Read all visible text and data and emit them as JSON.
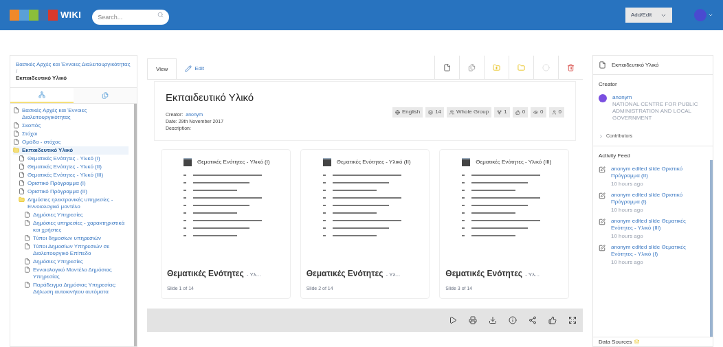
{
  "header": {
    "logo": "WIKI",
    "search": {
      "placeholder": "Search..."
    },
    "add_button": "Add/Edit"
  },
  "breadcrumb": {
    "parent": "Βασικές Αρχές και Έννοιες Διαλειτουργικότητας",
    "separator": "/",
    "current": "Εκπαιδευτικό Υλικό"
  },
  "sidebar_tabs": [
    {
      "kind": "tree",
      "selected": true
    },
    {
      "kind": "pages",
      "selected": false
    }
  ],
  "tree": [
    {
      "label": "Βασικές Αρχές και Έννοιες Διαλειτουργικότητας",
      "kind": "page",
      "selected": false
    },
    {
      "label": "Σκοπός",
      "kind": "page",
      "selected": false
    },
    {
      "label": "Στόχοι",
      "kind": "page",
      "selected": false
    },
    {
      "label": "Ομάδα - στόχος",
      "kind": "page",
      "selected": false
    },
    {
      "label": "Εκπαιδευτικό Υλικό",
      "kind": "folder",
      "selected": true,
      "children": [
        {
          "label": "Θεματικές Ενότητες - Υλικό (I)",
          "kind": "page",
          "selected": false
        },
        {
          "label": "Θεματικές Ενότητες - Υλικό (II)",
          "kind": "page",
          "selected": false
        },
        {
          "label": "Θεματικές Ενότητες - Υλικό (III)",
          "kind": "page",
          "selected": false
        },
        {
          "label": "Οριστικό Πρόγραμμα (I)",
          "kind": "page",
          "selected": false
        },
        {
          "label": "Οριστικό Πρόγραμμα (II)",
          "kind": "page",
          "selected": false
        },
        {
          "label": "Δημόσιες ηλεκτρονικές υπηρεσίες - Εννοιολογικό μοντέλο",
          "kind": "folder",
          "selected": false,
          "children": [
            {
              "label": "Δημόσιες Υπηρεσίες",
              "kind": "page",
              "selected": false
            },
            {
              "label": "Δημόσιες υπηρεσίες - χαρακτηριστικά και χρήστες",
              "kind": "page",
              "selected": false
            },
            {
              "label": "Τύποι δημοσίων υπηρεσιών",
              "kind": "page",
              "selected": false
            },
            {
              "label": "Τύποι Δημοσίων Υπηρεσιών σε Διαλειτουργικό Επίπεδο",
              "kind": "page",
              "selected": false
            },
            {
              "label": "Δημόσιες Υπηρεσίες",
              "kind": "page",
              "selected": false
            },
            {
              "label": "Εννοιολογικό Μοντέλο Δημόσιας Υπηρεσίας",
              "kind": "page",
              "selected": false
            },
            {
              "label": "Παράδειγμα Δημόσιας Υπηρεσίας: Δήλωση αυτοκινήτου αυτόματα",
              "kind": "page",
              "selected": false
            }
          ]
        }
      ]
    }
  ],
  "view_tabs": [
    {
      "label": "View",
      "selected": true,
      "kind": "view"
    },
    {
      "label": "Edit",
      "selected": false,
      "kind": "edit"
    }
  ],
  "deck": {
    "title": "Εκπαιδευτικό Υλικό",
    "creator_label": "Creator:",
    "creator": "anonym",
    "date": "Date: 29th November 2017",
    "description": "Description:",
    "badges": [
      {
        "kind": "language",
        "text": "English"
      },
      {
        "kind": "slides",
        "text": "14"
      },
      {
        "kind": "group",
        "text": "Whole Group"
      },
      {
        "kind": "forks",
        "text": "1"
      },
      {
        "kind": "likes",
        "text": "0"
      },
      {
        "kind": "views",
        "text": "0"
      },
      {
        "kind": "users",
        "text": "0"
      }
    ]
  },
  "slides": [
    {
      "heading": "Θεματικές Ενότητες - Υλικό (I)",
      "title": "Θεματικές Ενότητες",
      "suffix": "- Υλ...",
      "caption": "Slide 1 of 14"
    },
    {
      "heading": "Θεματικές Ενότητες - Υλικό (II)",
      "title": "Θεματικές Ενότητες",
      "suffix": "- Υλ...",
      "caption": "Slide 2 of 14"
    },
    {
      "heading": "Θεματικές Ενότητες - Υλικό (III)",
      "title": "Θεματικές Ενότητες",
      "suffix": "- Υλ...",
      "caption": "Slide 3 of 14"
    }
  ],
  "info_panel": {
    "title": "Εκπαιδευτικό Υλικό",
    "creator_heading": "Creator",
    "creator_name": "anonym",
    "organisation": "NATIONAL CENTRE FOR PUBLIC ADMINISTRATION AND LOCAL GOVERNMENT",
    "contributors": "Contributors",
    "activity_heading": "Activity Feed",
    "activities": [
      {
        "text": "anonym edited slide Οριστικό Πρόγραμμα (II)",
        "time": "10 hours ago"
      },
      {
        "text": "anonym edited slide Οριστικό Πρόγραμμα (I)",
        "time": "10 hours ago"
      },
      {
        "text": "anonym edited slide Θεματικές Ενότητες - Υλικό (III)",
        "time": "10 hours ago"
      },
      {
        "text": "anonym edited slide Θεματικές Ενότητες - Υλικό (I)",
        "time": "10 hours ago"
      }
    ],
    "data_sources": "Data Sources"
  }
}
